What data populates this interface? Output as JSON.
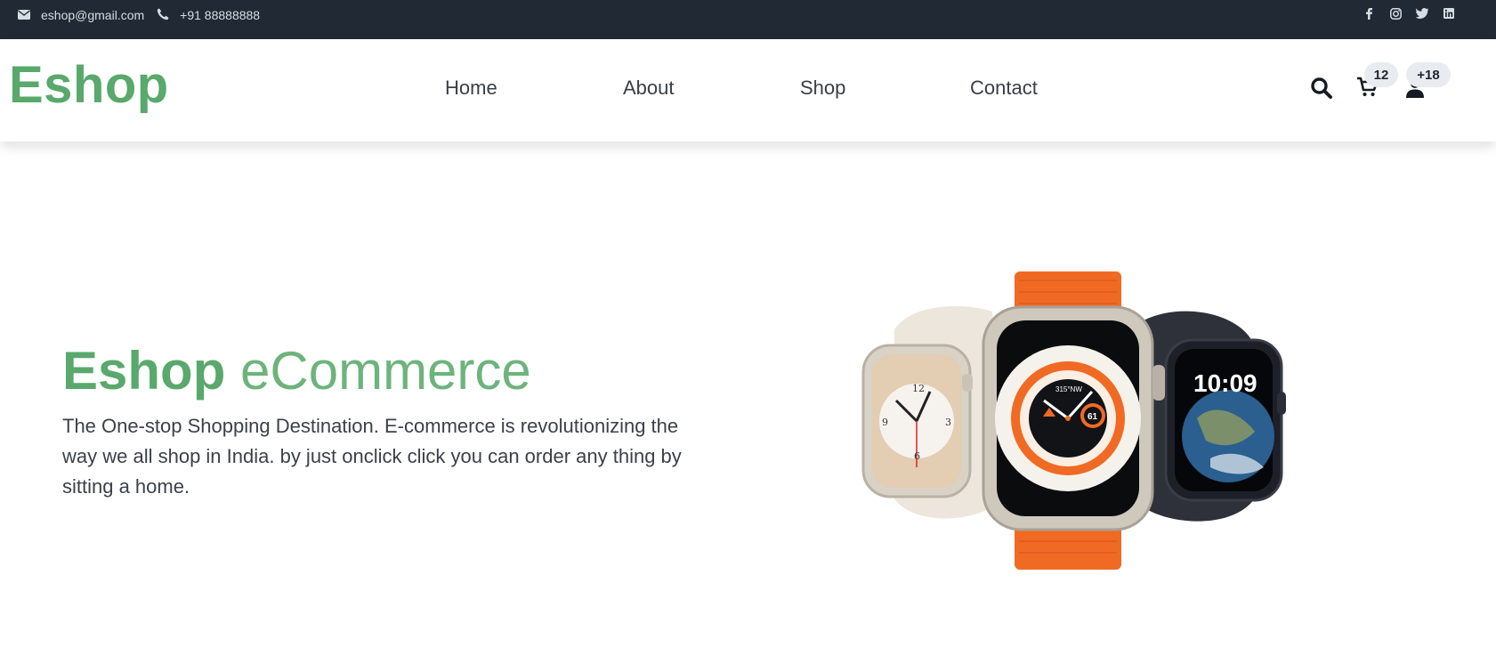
{
  "topbar": {
    "email": "eshop@gmail.com",
    "phone": "+91 88888888",
    "social": [
      "facebook-icon",
      "instagram-icon",
      "twitter-icon",
      "linkedin-icon"
    ]
  },
  "header": {
    "logo": "Eshop",
    "nav": [
      "Home",
      "About",
      "Shop",
      "Contact"
    ],
    "cart_count": "12",
    "user_count": "+18"
  },
  "hero": {
    "title_bold": "Eshop",
    "title_light": "eCommerce",
    "description": "The One-stop Shopping Destination. E-commerce is revolutionizing the way we all shop in India. by just onclick click you can order any thing by sitting a home.",
    "watch_time": "10:09"
  },
  "colors": {
    "brand": "#59a86c",
    "topbar": "#212934"
  }
}
